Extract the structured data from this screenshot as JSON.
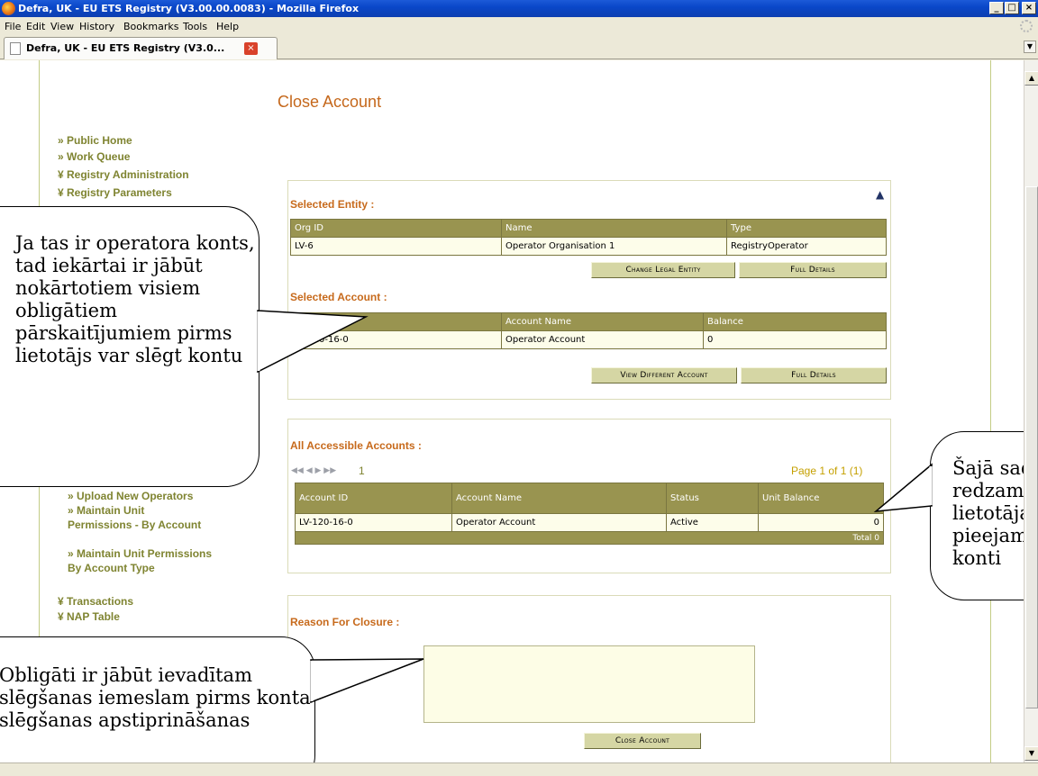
{
  "window": {
    "title": "Defra, UK - EU ETS Registry (V3.00.00.0083) - Mozilla Firefox",
    "minimize": "_",
    "maximize": "□",
    "close": "×"
  },
  "menu": [
    "File",
    "Edit",
    "View",
    "History",
    "Bookmarks",
    "Tools",
    "Help"
  ],
  "tab": {
    "title": "Defra, UK - EU ETS Registry (V3.0...",
    "close": "×"
  },
  "page": {
    "heading": "Close Account"
  },
  "nav": {
    "top": [
      "» Public Home",
      "» Work Queue",
      "¥ Registry Administration",
      "¥ Registry Parameters"
    ],
    "sub": [
      "» Upload New Operators",
      "» Maintain Unit Permissions - By Account",
      "» Maintain Unit Permissions By Account Type"
    ],
    "bottom": [
      "¥ Transactions",
      "¥ NAP Table"
    ]
  },
  "entity": {
    "title": "Selected Entity :",
    "headers": [
      "Org ID",
      "Name",
      "Type"
    ],
    "row": [
      "LV-6",
      "Operator Organisation 1",
      "RegistryOperator"
    ],
    "btn_change": "Change Legal Entity",
    "btn_details": "Full Details"
  },
  "account": {
    "title": "Selected Account :",
    "headers": [
      "Account ID",
      "Account Name",
      "Balance"
    ],
    "row": [
      "LV-120-16-0",
      "Operator Account",
      "0"
    ],
    "btn_view": "View Different Account",
    "btn_details": "Full Details"
  },
  "accessible": {
    "title": "All Accessible Accounts :",
    "pager_controls": "◀◀ ◀ ▶ ▶▶",
    "pager_page": "1",
    "page_info": "Page 1 of 1  (1)",
    "headers": [
      "Account ID",
      "Account Name",
      "Status",
      "Unit Balance"
    ],
    "row": [
      "LV-120-16-0",
      "Operator Account",
      "Active",
      "0"
    ],
    "total": "Total  0"
  },
  "closure": {
    "title": "Reason For Closure :",
    "textarea_value": "",
    "btn_close": "Close Account"
  },
  "callouts": {
    "left_top": "Ja tas ir operatora konts, tad iekārtai ir jābūt nokārtotiem visiem obligātiem pārskaitījumiem pirms lietotājs var slēgt kontu",
    "right": "Šajā sadaļā redzami lietotājam pieejamie konti",
    "left_bottom": "Obligāti ir jābūt ievadītam slēgšanas iemeslam pirms konta slēgšanas apstiprināšanas"
  }
}
